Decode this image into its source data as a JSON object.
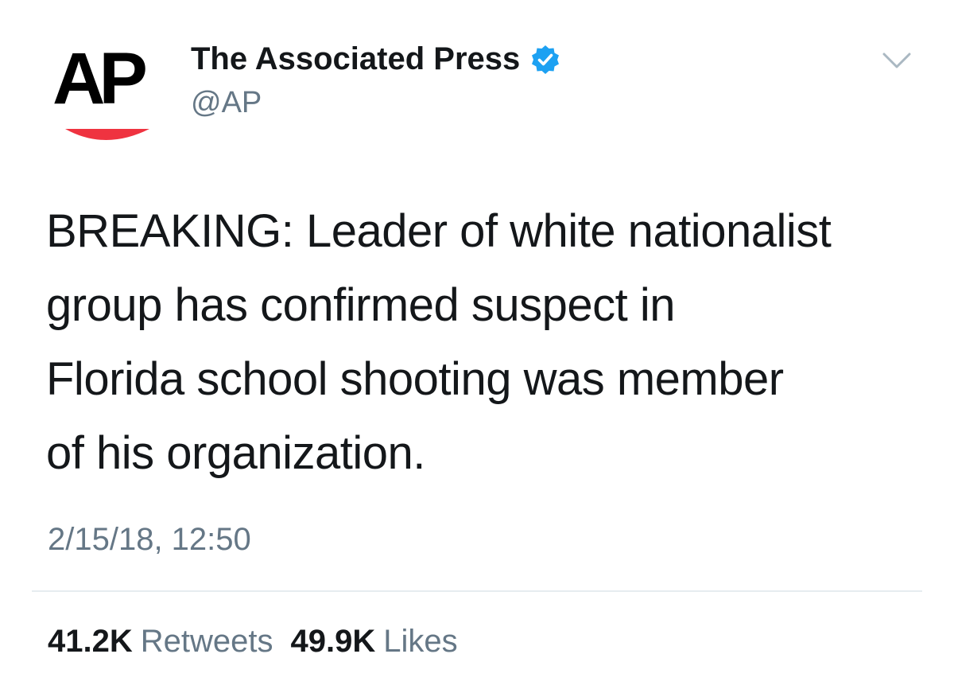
{
  "account": {
    "display_name": "The Associated Press",
    "handle": "@AP",
    "avatar_text": "AP",
    "verified_icon": "verified-badge-icon",
    "verified_color": "#1da1f2",
    "logo_accent_color": "#ef3340"
  },
  "tweet": {
    "text": "BREAKING: Leader of white nationalist\ngroup has confirmed suspect in\nFlorida school shooting was member\nof his organization.",
    "timestamp": "2/15/18, 12:50"
  },
  "stats": {
    "retweets_count": "41.2K",
    "retweets_label": "Retweets",
    "likes_count": "49.9K",
    "likes_label": "Likes"
  },
  "menu": {
    "icon": "chevron-down-icon"
  }
}
